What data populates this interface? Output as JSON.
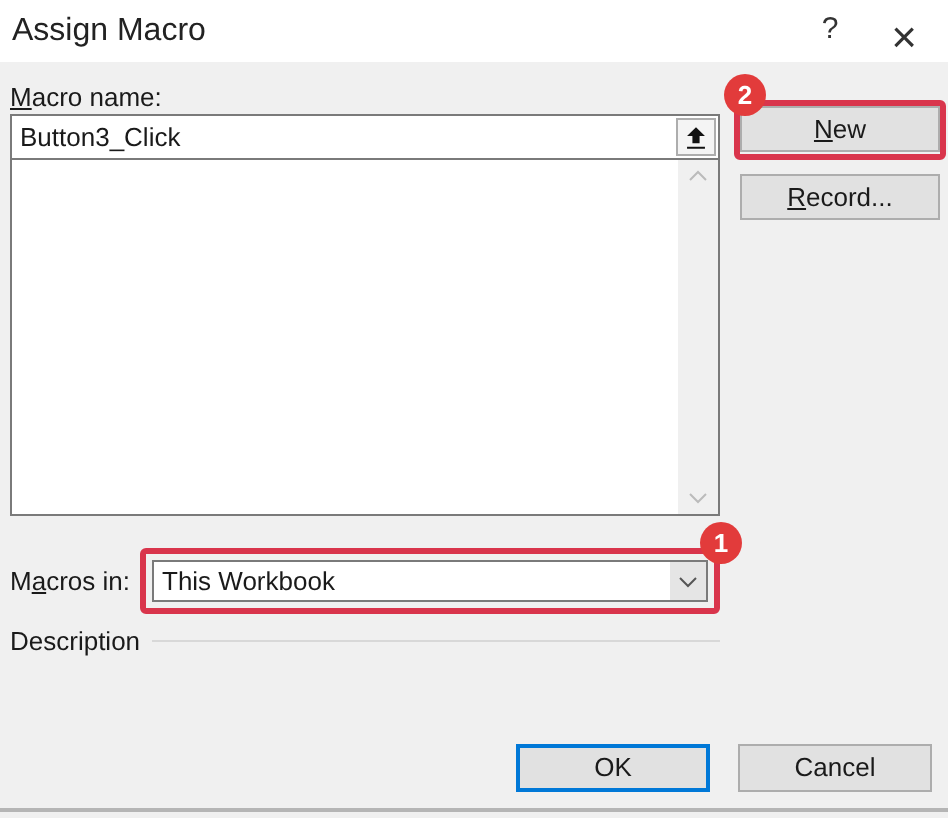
{
  "window": {
    "title": "Assign Macro",
    "help": "?",
    "close": "×"
  },
  "macro_name": {
    "label": [
      {
        "text": "M",
        "underline": true
      },
      {
        "text": "acro name:",
        "underline": false
      }
    ],
    "value": "Button3_Click"
  },
  "macros_in": {
    "label": [
      {
        "text": "M",
        "underline": false
      },
      {
        "text": "a",
        "underline": true
      },
      {
        "text": "cros in:",
        "underline": false
      }
    ],
    "value": "This Workbook",
    "callout": "1"
  },
  "description": {
    "label": "Description"
  },
  "side_buttons": [
    {
      "label": [
        {
          "text": "N",
          "underline": true
        },
        {
          "text": "ew",
          "underline": false
        }
      ],
      "callout": "2"
    },
    {
      "label": [
        {
          "text": "R",
          "underline": true
        },
        {
          "text": "ecord...",
          "underline": false
        }
      ]
    }
  ],
  "footer_buttons": [
    {
      "label": "OK",
      "default": true
    },
    {
      "label": "Cancel",
      "default": false
    }
  ]
}
